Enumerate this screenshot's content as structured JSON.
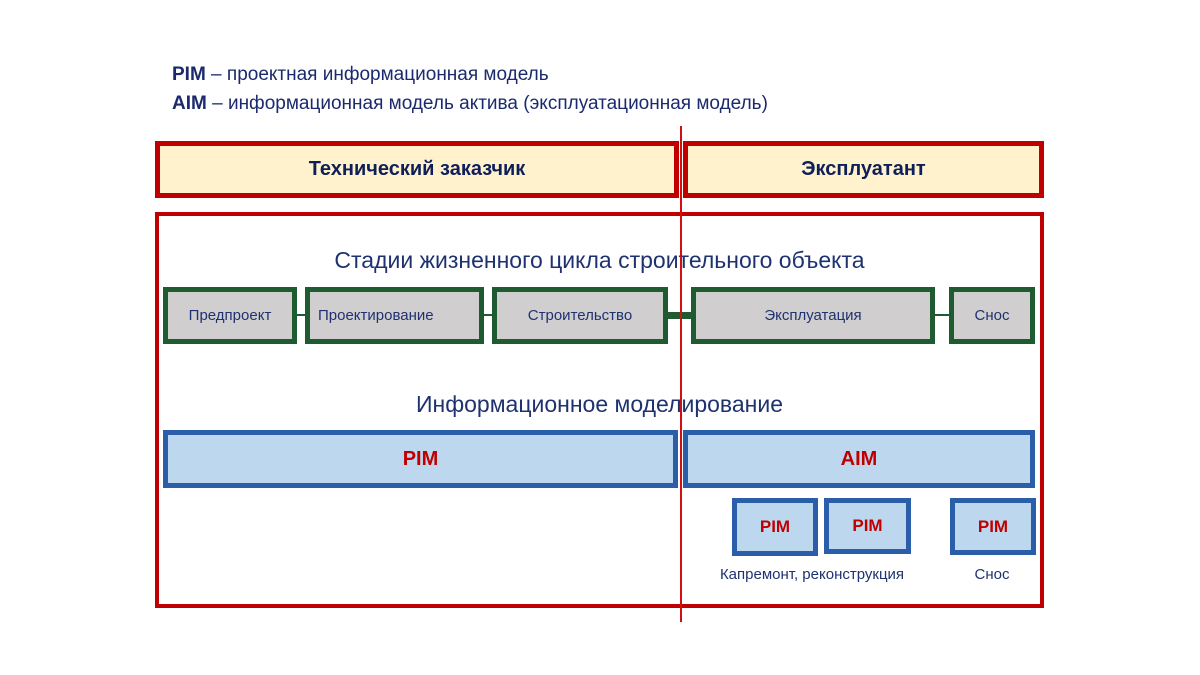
{
  "legend": [
    {
      "abbr": "PIM",
      "text": " – проектная информационная модель"
    },
    {
      "abbr": "AIM",
      "text": " – информационная модель актива (эксплуатационная модель)"
    }
  ],
  "roles": {
    "left": "Технический заказчик",
    "right": "Эксплуатант"
  },
  "lifecycle": {
    "title": "Стадии жизненного цикла строительного объекта",
    "stages": [
      "Предпроект",
      "Проектирование",
      "Строительство",
      "Эксплуатация",
      "Снос"
    ]
  },
  "modeling": {
    "title": "Информационное моделирование",
    "pim_bar": "PIM",
    "aim_bar": "AIM",
    "sub_models": [
      "PIM",
      "PIM",
      "PIM"
    ],
    "captions": [
      "Капремонт, реконструкция",
      "Снос"
    ]
  },
  "colors": {
    "frame_red": "#c00000",
    "role_fill": "#fff2cc",
    "stage_border": "#1e5b31",
    "stage_fill": "#d0cece",
    "model_border": "#2a5ea8",
    "model_fill": "#bdd7ee",
    "text_navy": "#1f3270"
  }
}
